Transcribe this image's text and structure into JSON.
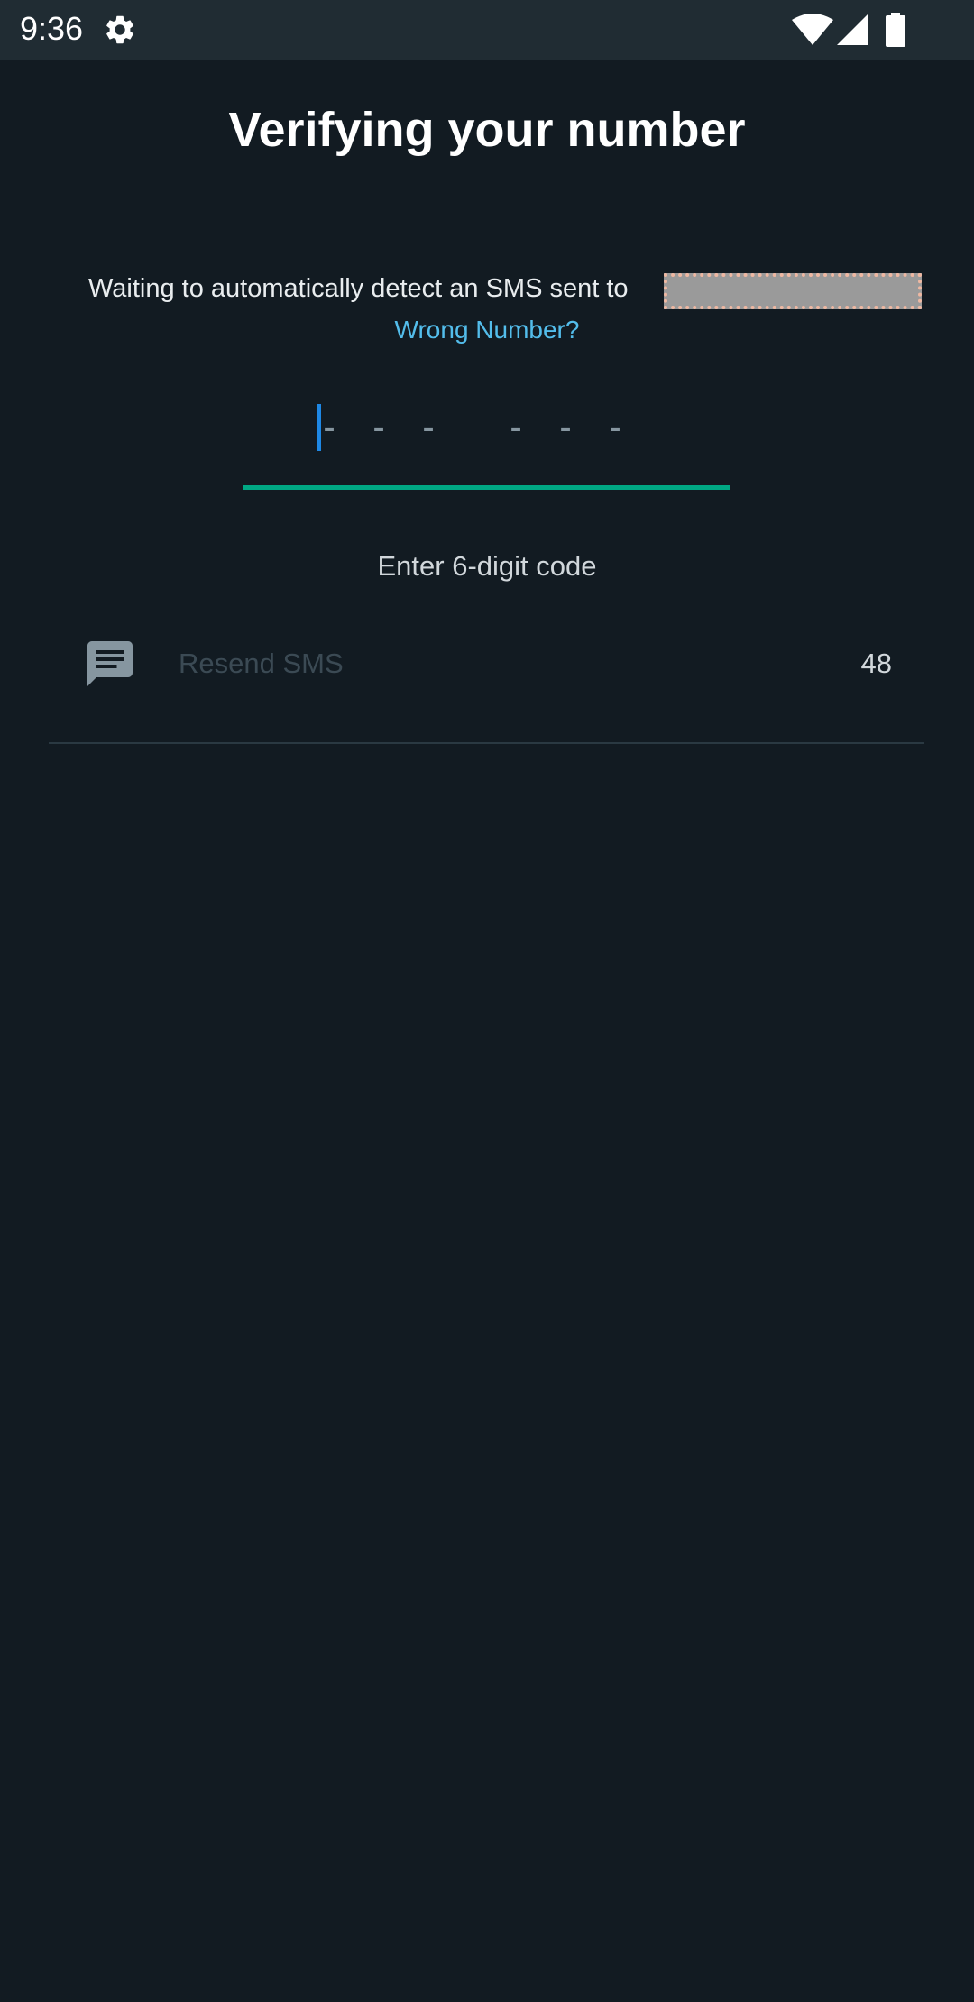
{
  "status_bar": {
    "time": "9:36",
    "icons": [
      "gear-icon",
      "wifi-icon",
      "signal-icon",
      "battery-icon"
    ]
  },
  "page": {
    "title": "Verifying your number",
    "waiting_text": "Waiting to automatically detect an SMS sent to",
    "wrong_number_link": "Wrong Number?",
    "code_placeholder": [
      "-",
      "-",
      "-",
      "-",
      "-",
      "-"
    ],
    "code_hint": "Enter 6-digit code",
    "resend_label": "Resend SMS",
    "resend_timer": "48"
  },
  "colors": {
    "background": "#121b22",
    "status_bar": "#202c33",
    "accent": "#00a884",
    "link": "#53bdeb",
    "cursor": "#1e88e5"
  }
}
